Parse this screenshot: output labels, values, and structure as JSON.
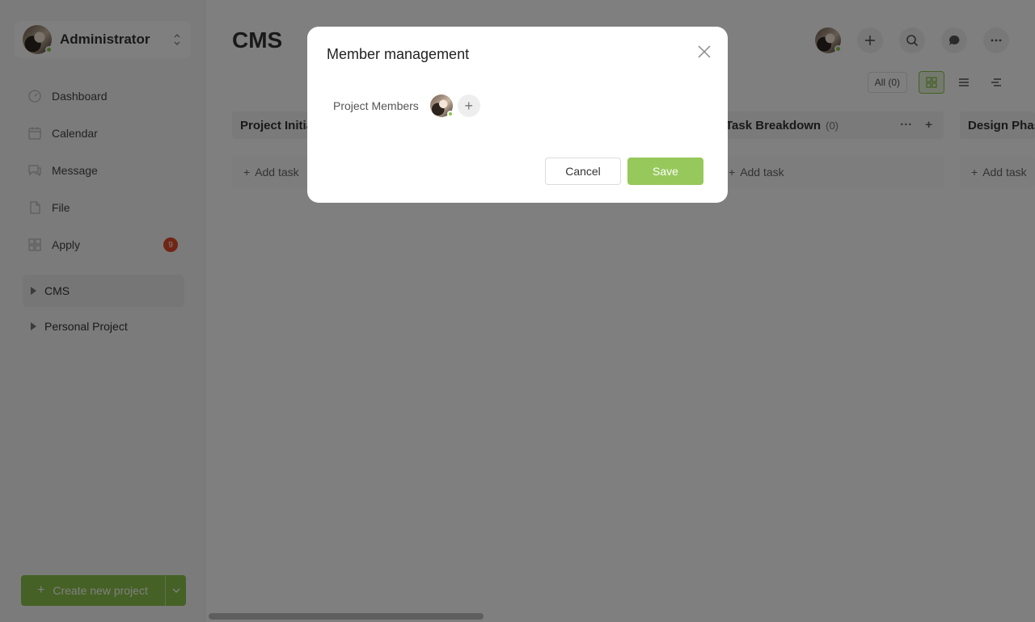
{
  "sidebar": {
    "user_name": "Administrator",
    "nav": [
      {
        "label": "Dashboard",
        "icon": "dashboard-icon"
      },
      {
        "label": "Calendar",
        "icon": "calendar-icon"
      },
      {
        "label": "Message",
        "icon": "message-icon"
      },
      {
        "label": "File",
        "icon": "file-icon"
      },
      {
        "label": "Apply",
        "icon": "apply-icon",
        "badge": "9"
      }
    ],
    "projects": [
      {
        "label": "CMS",
        "active": true
      },
      {
        "label": "Personal Project",
        "active": false
      }
    ],
    "create_label": "Create new project"
  },
  "main": {
    "title": "CMS",
    "filter_all": "All (0)",
    "columns": [
      {
        "title": "Project Initia",
        "count": "",
        "add_task": "Add task"
      },
      {
        "title": "Task Breakdown",
        "count": "(0)",
        "add_task": "Add task"
      },
      {
        "title": "Design Phas",
        "count": "",
        "add_task": "Add task"
      }
    ]
  },
  "modal": {
    "title": "Member management",
    "members_label": "Project Members",
    "cancel_label": "Cancel",
    "save_label": "Save"
  },
  "colors": {
    "accent": "#8bc34a",
    "badge": "#e04b2a"
  }
}
